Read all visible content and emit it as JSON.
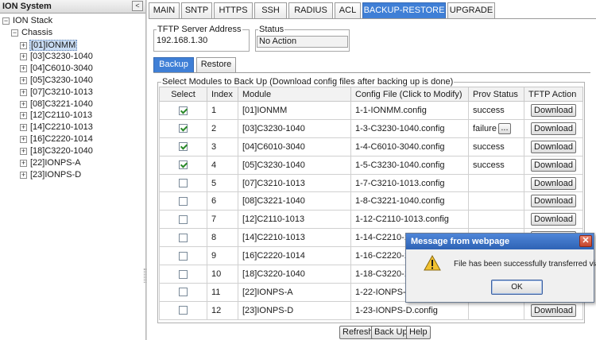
{
  "left_panel": {
    "title": "ION System",
    "collapse_glyph": "<",
    "tree": {
      "root": {
        "label": "ION Stack",
        "expander": "−"
      },
      "chassis": {
        "label": "Chassis",
        "expander": "−"
      },
      "modules": [
        {
          "label": "[01]IONMM",
          "expander": "+",
          "selected": true
        },
        {
          "label": "[03]C3230-1040",
          "expander": "+"
        },
        {
          "label": "[04]C6010-3040",
          "expander": "+"
        },
        {
          "label": "[05]C3230-1040",
          "expander": "+"
        },
        {
          "label": "[07]C3210-1013",
          "expander": "+"
        },
        {
          "label": "[08]C3221-1040",
          "expander": "+"
        },
        {
          "label": "[12]C2110-1013",
          "expander": "+"
        },
        {
          "label": "[14]C2210-1013",
          "expander": "+"
        },
        {
          "label": "[16]C2220-1014",
          "expander": "+"
        },
        {
          "label": "[18]C3220-1040",
          "expander": "+"
        },
        {
          "label": "[22]IONPS-A",
          "expander": "+"
        },
        {
          "label": "[23]IONPS-D",
          "expander": "+"
        }
      ]
    }
  },
  "tabs": [
    {
      "label": "MAIN"
    },
    {
      "label": "SNTP"
    },
    {
      "label": "HTTPS"
    },
    {
      "label": "SSH"
    },
    {
      "label": "RADIUS"
    },
    {
      "label": "ACL"
    },
    {
      "label": "BACKUP-RESTORE",
      "active": true
    },
    {
      "label": "UPGRADE"
    }
  ],
  "tftp": {
    "server_legend": "TFTP Server Address",
    "server_value": "192.168.1.30",
    "status_legend": "Status",
    "status_value": "No Action"
  },
  "subtabs": [
    {
      "label": "Backup",
      "active": true
    },
    {
      "label": "Restore"
    }
  ],
  "modules_section": {
    "legend": "Select Modules to Back Up (Download config files after backing up is done)",
    "columns": [
      "Select",
      "Index",
      "Module",
      "Config File (Click to Modify)",
      "Prov Status",
      "TFTP Action"
    ],
    "rows": [
      {
        "checked": true,
        "index": "1",
        "module": "[01]IONMM",
        "config": "1-1-IONMM.config",
        "prov": "success",
        "action": "Download"
      },
      {
        "checked": true,
        "index": "2",
        "module": "[03]C3230-1040",
        "config": "1-3-C3230-1040.config",
        "prov": "failure",
        "prov_more": "...",
        "action": "Download"
      },
      {
        "checked": true,
        "index": "3",
        "module": "[04]C6010-3040",
        "config": "1-4-C6010-3040.config",
        "prov": "success",
        "action": "Download"
      },
      {
        "checked": true,
        "index": "4",
        "module": "[05]C3230-1040",
        "config": "1-5-C3230-1040.config",
        "prov": "success",
        "action": "Download"
      },
      {
        "checked": false,
        "index": "5",
        "module": "[07]C3210-1013",
        "config": "1-7-C3210-1013.config",
        "prov": "",
        "action": "Download"
      },
      {
        "checked": false,
        "index": "6",
        "module": "[08]C3221-1040",
        "config": "1-8-C3221-1040.config",
        "prov": "",
        "action": "Download"
      },
      {
        "checked": false,
        "index": "7",
        "module": "[12]C2110-1013",
        "config": "1-12-C2110-1013.config",
        "prov": "",
        "action": "Download"
      },
      {
        "checked": false,
        "index": "8",
        "module": "[14]C2210-1013",
        "config": "1-14-C2210-10",
        "prov": "",
        "action": "Download"
      },
      {
        "checked": false,
        "index": "9",
        "module": "[16]C2220-1014",
        "config": "1-16-C2220-10",
        "prov": "",
        "action": "Download"
      },
      {
        "checked": false,
        "index": "10",
        "module": "[18]C3220-1040",
        "config": "1-18-C3220-10",
        "prov": "",
        "action": "Download"
      },
      {
        "checked": false,
        "index": "11",
        "module": "[22]IONPS-A",
        "config": "1-22-IONPS-A",
        "prov": "",
        "action": "Download"
      },
      {
        "checked": false,
        "index": "12",
        "module": "[23]IONPS-D",
        "config": "1-23-IONPS-D.config",
        "prov": "",
        "action": "Download"
      }
    ]
  },
  "bottom_buttons": {
    "refresh": "Refresh",
    "backup": "Back Up",
    "help": "Help"
  },
  "dialog": {
    "title": "Message from webpage",
    "close_glyph": "✕",
    "icon": "warning-icon",
    "message": "File has been successfully transferred via TFTP.",
    "ok_label": "OK"
  },
  "colors": {
    "active_tab": "#3f7fd6",
    "dialog_title": "#2e63b5",
    "warning": "#f2c230",
    "check": "#2a8a2a"
  }
}
